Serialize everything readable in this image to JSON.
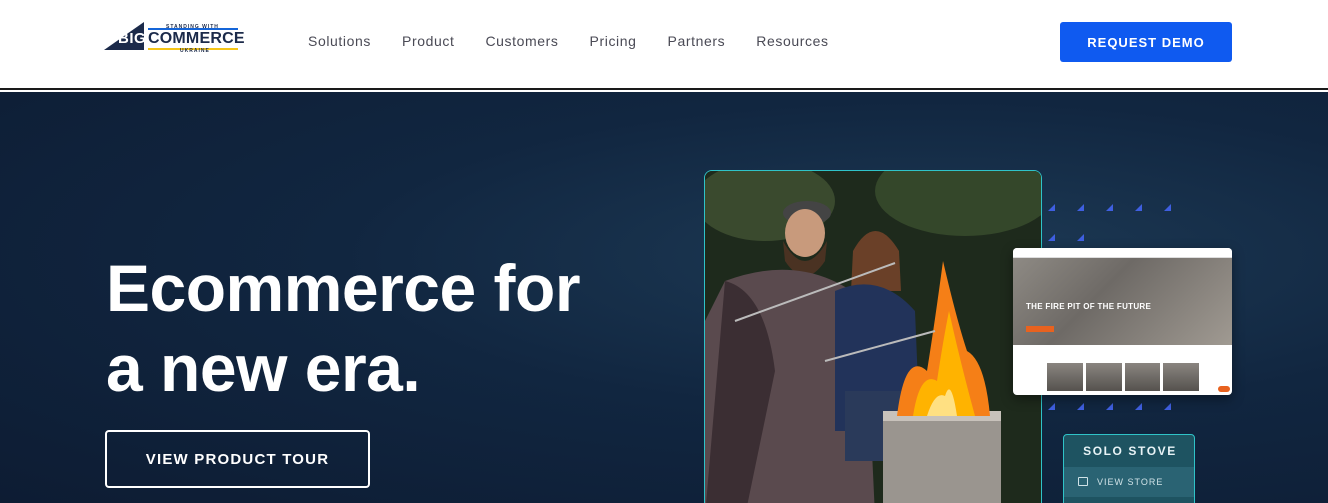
{
  "header": {
    "logo": {
      "big": "BIG",
      "commerce": "COMMERCE",
      "tag_top": "STANDING WITH",
      "tag_bottom": "UKRAINE"
    },
    "nav": [
      "Solutions",
      "Product",
      "Customers",
      "Pricing",
      "Partners",
      "Resources"
    ],
    "cta": "REQUEST DEMO"
  },
  "hero": {
    "title_line1": "Ecommerce for",
    "title_line2": "a new era.",
    "button": "VIEW PRODUCT TOUR"
  },
  "showcase": {
    "store_heading": "THE FIRE PIT OF THE FUTURE",
    "brand": "SOLO STOVE",
    "view_store": "VIEW STORE"
  },
  "colors": {
    "accent": "#0f5af0",
    "hero_bg": "#112640",
    "card_border": "#2fc3c8",
    "solo_bg": "#1e5361"
  }
}
